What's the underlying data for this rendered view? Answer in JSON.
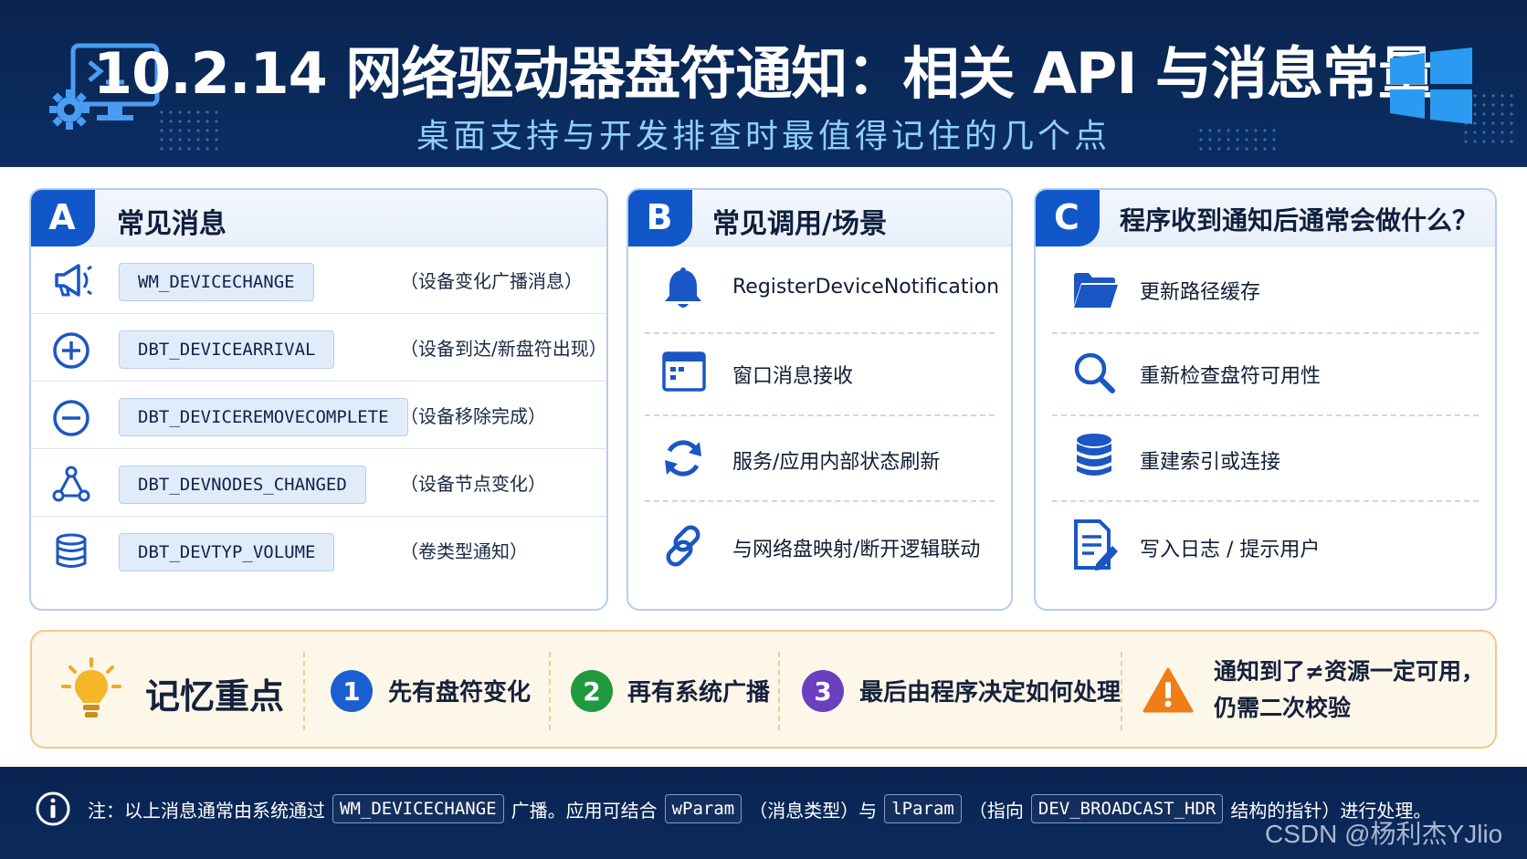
{
  "header": {
    "title": "10.2.14 网络驱动器盘符通知：相关 API 与消息常量",
    "subtitle": "桌面支持与开发排查时最值得记住的几个点",
    "left_icon": "terminal-gear-icon",
    "right_icon": "windows-logo-icon"
  },
  "panel_a": {
    "letter": "A",
    "title": "常见消息",
    "items": [
      {
        "icon": "megaphone-icon",
        "code": "WM_DEVICECHANGE",
        "desc": "（设备变化广播消息）"
      },
      {
        "icon": "plus-circle-icon",
        "code": "DBT_DEVICEARRIVAL",
        "desc": "（设备到达/新盘符出现）"
      },
      {
        "icon": "minus-circle-icon",
        "code": "DBT_DEVICEREMOVECOMPLETE",
        "desc": "（设备移除完成）"
      },
      {
        "icon": "nodes-icon",
        "code": "DBT_DEVNODES_CHANGED",
        "desc": "（设备节点变化）"
      },
      {
        "icon": "database-icon",
        "code": "DBT_DEVTYP_VOLUME",
        "desc": "（卷类型通知）"
      }
    ]
  },
  "panel_b": {
    "letter": "B",
    "title": "常见调用/场景",
    "items": [
      {
        "icon": "bell-icon",
        "label": "RegisterDeviceNotification"
      },
      {
        "icon": "window-icon",
        "label": "窗口消息接收"
      },
      {
        "icon": "refresh-icon",
        "label": "服务/应用内部状态刷新"
      },
      {
        "icon": "link-icon",
        "label": "与网络盘映射/断开逻辑联动"
      }
    ]
  },
  "panel_c": {
    "letter": "C",
    "title": "程序收到通知后通常会做什么？",
    "items": [
      {
        "icon": "folder-icon",
        "label": "更新路径缓存"
      },
      {
        "icon": "magnifier-icon",
        "label": "重新检查盘符可用性"
      },
      {
        "icon": "database-icon",
        "label": "重建索引或连接"
      },
      {
        "icon": "document-edit-icon",
        "label": "写入日志 / 提示用户"
      }
    ]
  },
  "memory": {
    "icon": "lightbulb-icon",
    "title": "记忆重点",
    "steps": [
      {
        "num": "1",
        "text": "先有盘符变化",
        "color": "#1a5fd0"
      },
      {
        "num": "2",
        "text": "再有系统广播",
        "color": "#1f9a3f"
      },
      {
        "num": "3",
        "text": "最后由程序决定如何处理",
        "color": "#6a3fc0"
      }
    ],
    "warning_icon": "warning-triangle-icon",
    "warning_line1": "通知到了≠资源一定可用，",
    "warning_line2": "仍需二次校验"
  },
  "footer": {
    "icon": "info-icon",
    "t1": "注：以上消息通常由系统通过",
    "c1": "WM_DEVICECHANGE",
    "t2": "广播。应用可结合",
    "c2": "wParam",
    "t3": "（消息类型）与",
    "c3": "lParam",
    "t4": "（指向",
    "c4": "DEV_BROADCAST_HDR",
    "t5": "结构的指针）进行处理。",
    "watermark": "CSDN @杨利杰YJlio"
  },
  "colors": {
    "header_bg": "#0b2450",
    "accent_blue": "#1257c9",
    "subtitle": "#8fd0ff",
    "memory_bg": "#fdf7ea",
    "memory_border": "#f0c98b",
    "warning": "#f07d16"
  }
}
